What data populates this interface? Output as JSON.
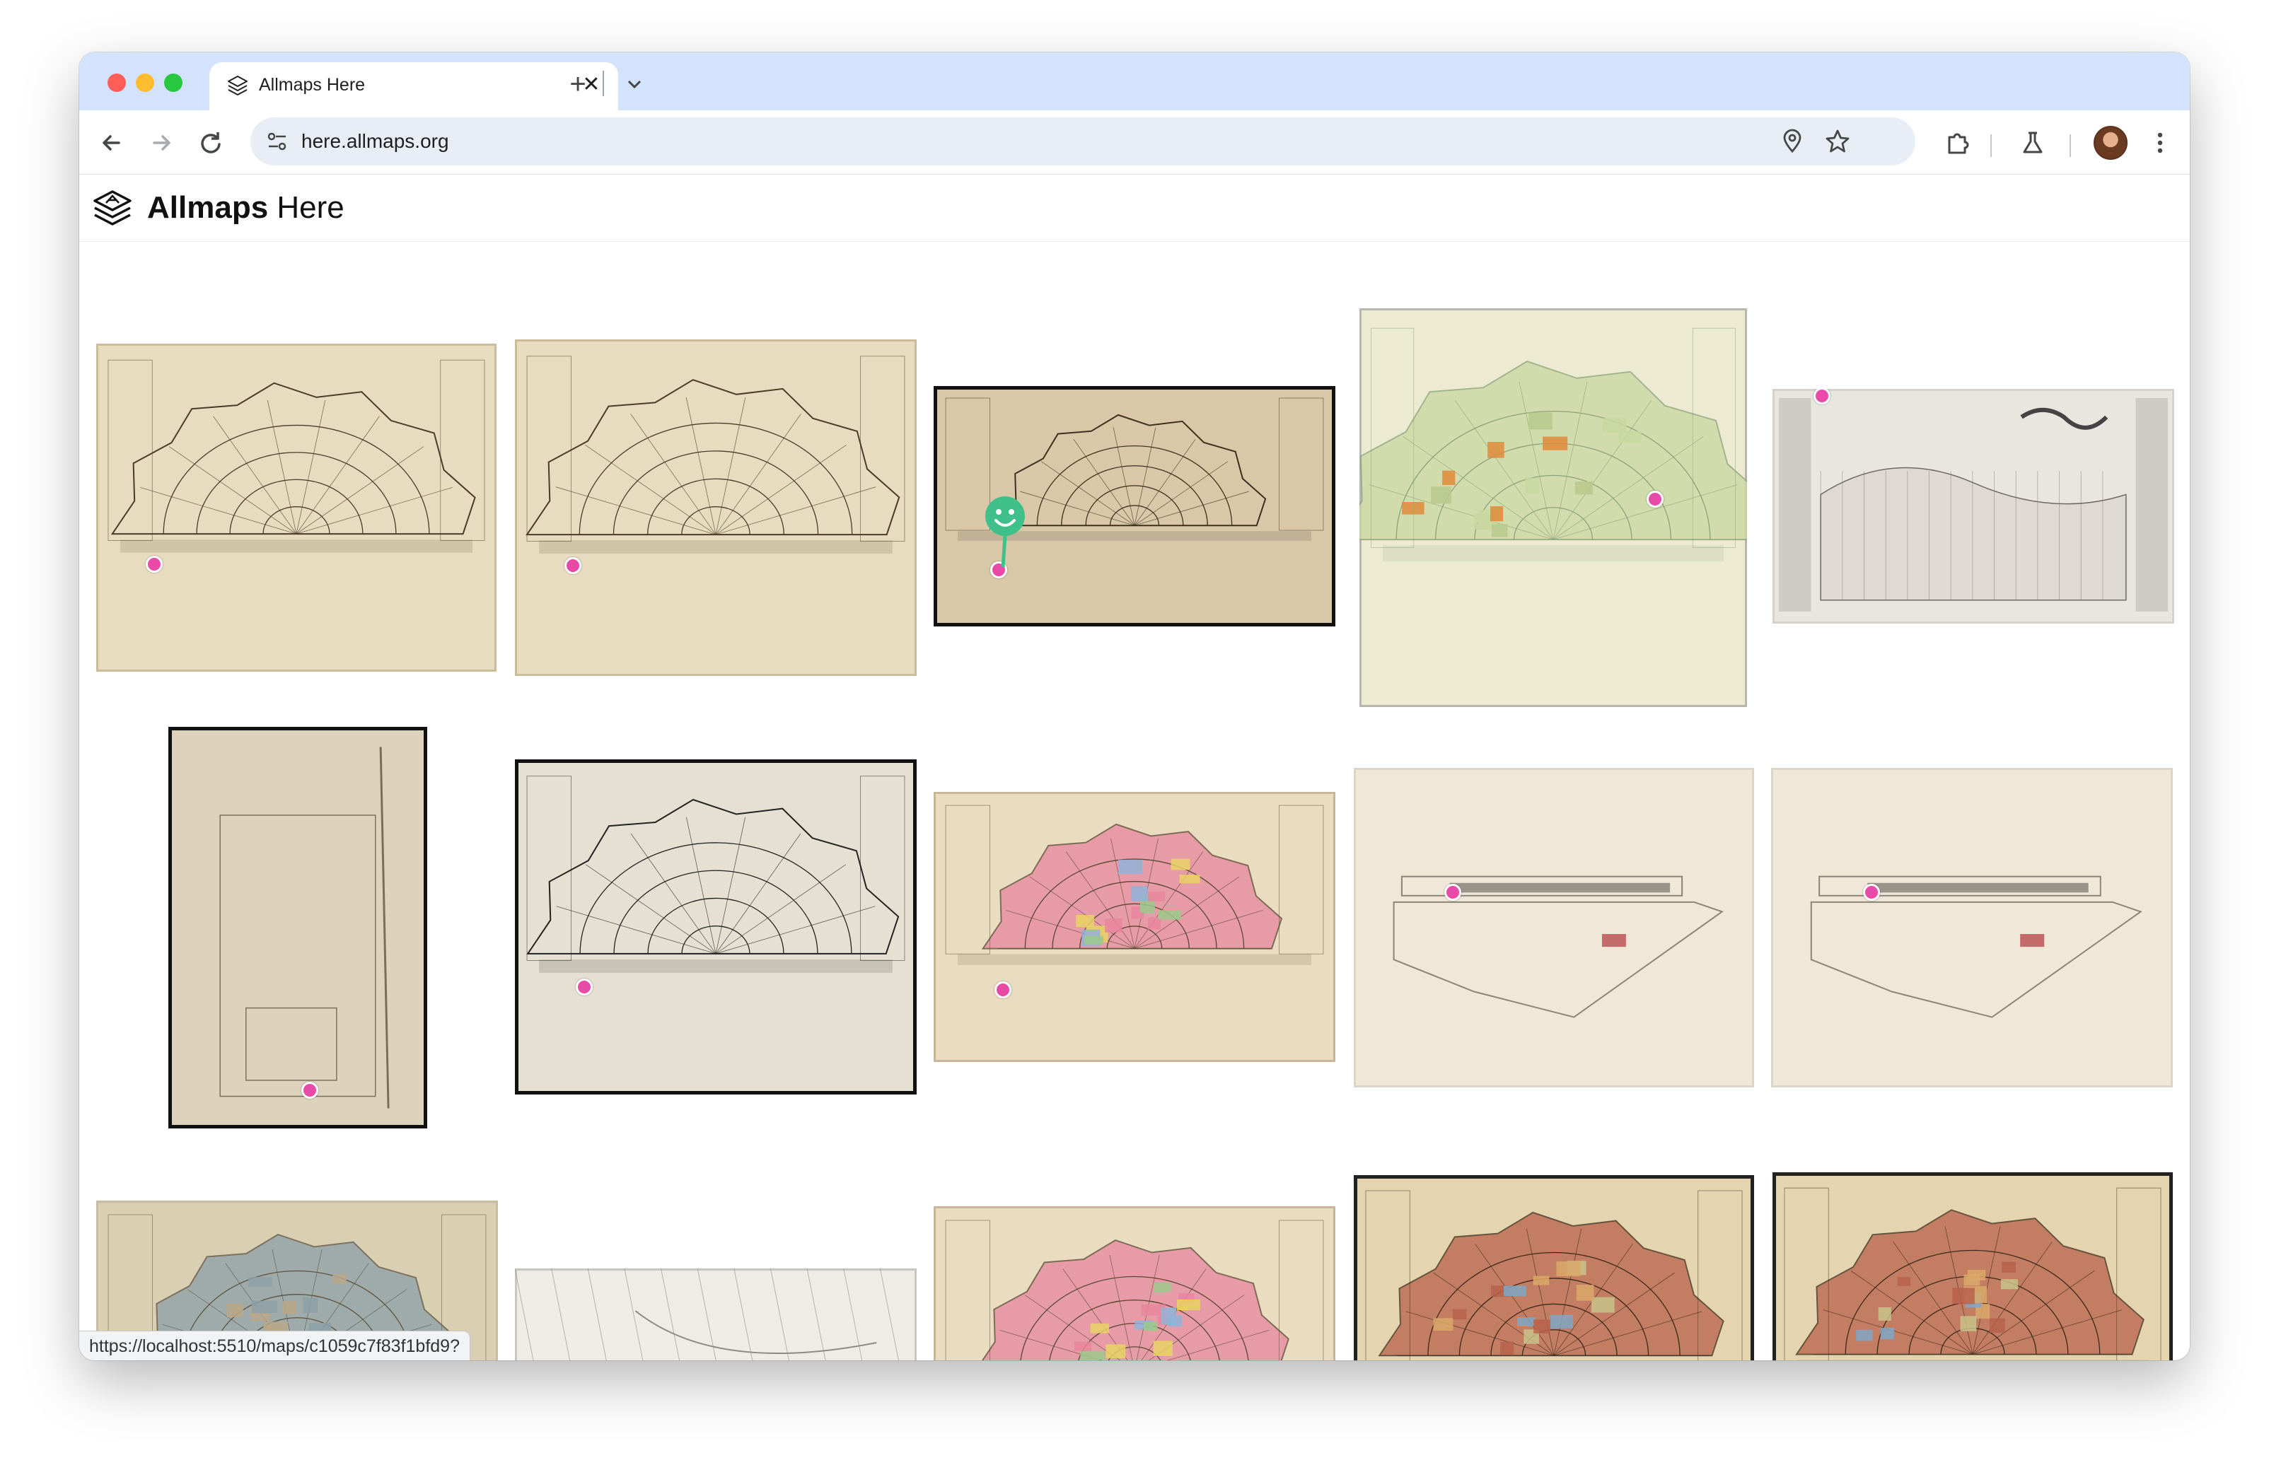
{
  "browser": {
    "tab": {
      "title": "Allmaps Here",
      "favicon": "allmaps-logo-icon"
    },
    "address_bar": {
      "url": "here.allmaps.org"
    },
    "status_bar_url": "https://localhost:5510/maps/c1059c7f83f1bfd9?",
    "colors": {
      "tab_strip": "#d3e3fd",
      "omnibox": "#e9eef6"
    }
  },
  "site": {
    "brand_bold": "Allmaps",
    "brand_light": " Here",
    "pin_color": "#e94aa8",
    "smiley_color": "#3fc08a"
  },
  "maps": [
    {
      "style": "engraving"
    },
    {
      "style": "engraving"
    },
    {
      "style": "engraving-dark-frame"
    },
    {
      "style": "colored-plan"
    },
    {
      "style": "grey-panorama"
    },
    {
      "style": "sketch-plan"
    },
    {
      "style": "engraving-framed"
    },
    {
      "style": "colored-city"
    },
    {
      "style": "buurt-plan"
    },
    {
      "style": "buurt-plan"
    },
    {
      "style": "bird-view"
    },
    {
      "style": "outline-plan"
    },
    {
      "style": "colored-city"
    },
    {
      "style": "colored-city-framed"
    },
    {
      "style": "colored-city-framed"
    }
  ]
}
